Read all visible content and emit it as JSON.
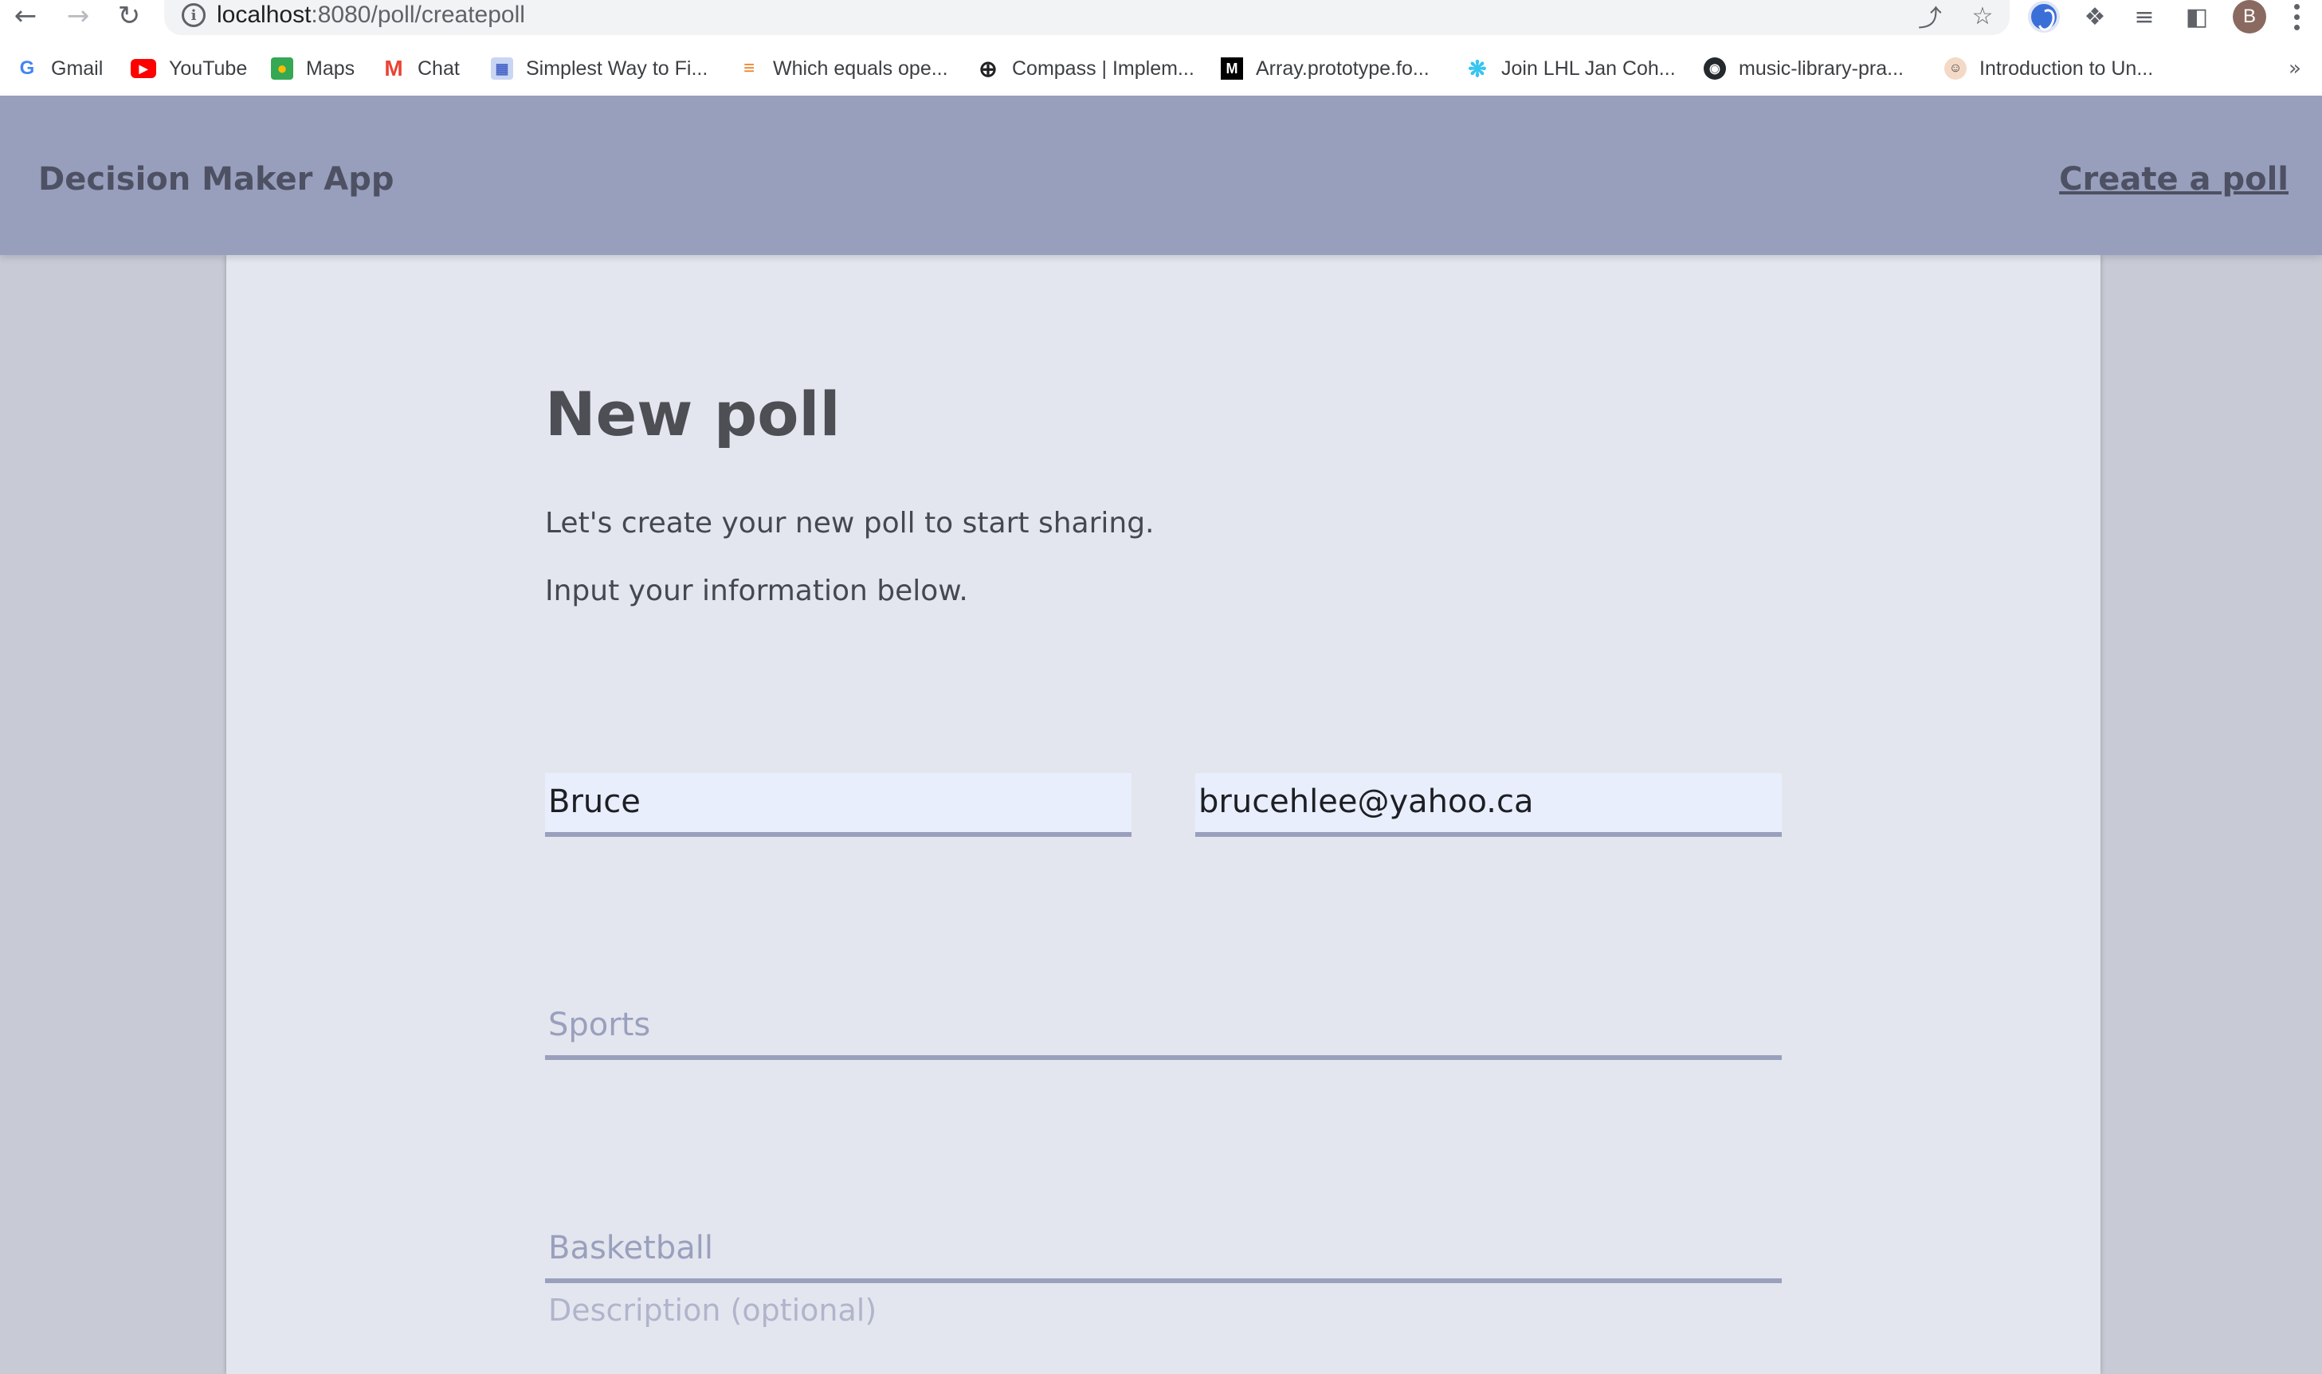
{
  "browser": {
    "url_host": "localhost",
    "url_path": ":8080/poll/createpoll",
    "profile_initial": "B",
    "bookmarks": [
      {
        "label": "Gmail",
        "icon": "google-icon"
      },
      {
        "label": "YouTube",
        "icon": "youtube-icon"
      },
      {
        "label": "Maps",
        "icon": "maps-icon"
      },
      {
        "label": "Chat",
        "icon": "gmail-icon"
      },
      {
        "label": "Simplest Way to Fi...",
        "icon": "page-icon"
      },
      {
        "label": "Which equals ope...",
        "icon": "stackoverflow-icon"
      },
      {
        "label": "Compass | Implem...",
        "icon": "compass-icon"
      },
      {
        "label": "Array.prototype.fo...",
        "icon": "mdn-icon"
      },
      {
        "label": "Join LHL Jan Coh...",
        "icon": "slack-icon"
      },
      {
        "label": "music-library-pra...",
        "icon": "github-icon"
      },
      {
        "label": "Introduction to Un...",
        "icon": "avatar-icon"
      }
    ],
    "more_bookmarks": "»"
  },
  "header": {
    "brand": "Decision Maker App",
    "create_link": "Create a poll"
  },
  "main": {
    "title": "New poll",
    "lead_1": "Let's create your new poll to start sharing.",
    "lead_2": "Input your information below.",
    "name_value": "Bruce",
    "email_value": "brucehlee@yahoo.ca",
    "poll_title_placeholder": "Sports",
    "option_placeholder": "Basketball",
    "description_placeholder": "Description (optional)"
  },
  "colors": {
    "header_bg": "#989fbc",
    "panel_bg": "#e3e6ef",
    "page_bg": "#c8cad6",
    "field_underline": "#9aa0bc"
  }
}
